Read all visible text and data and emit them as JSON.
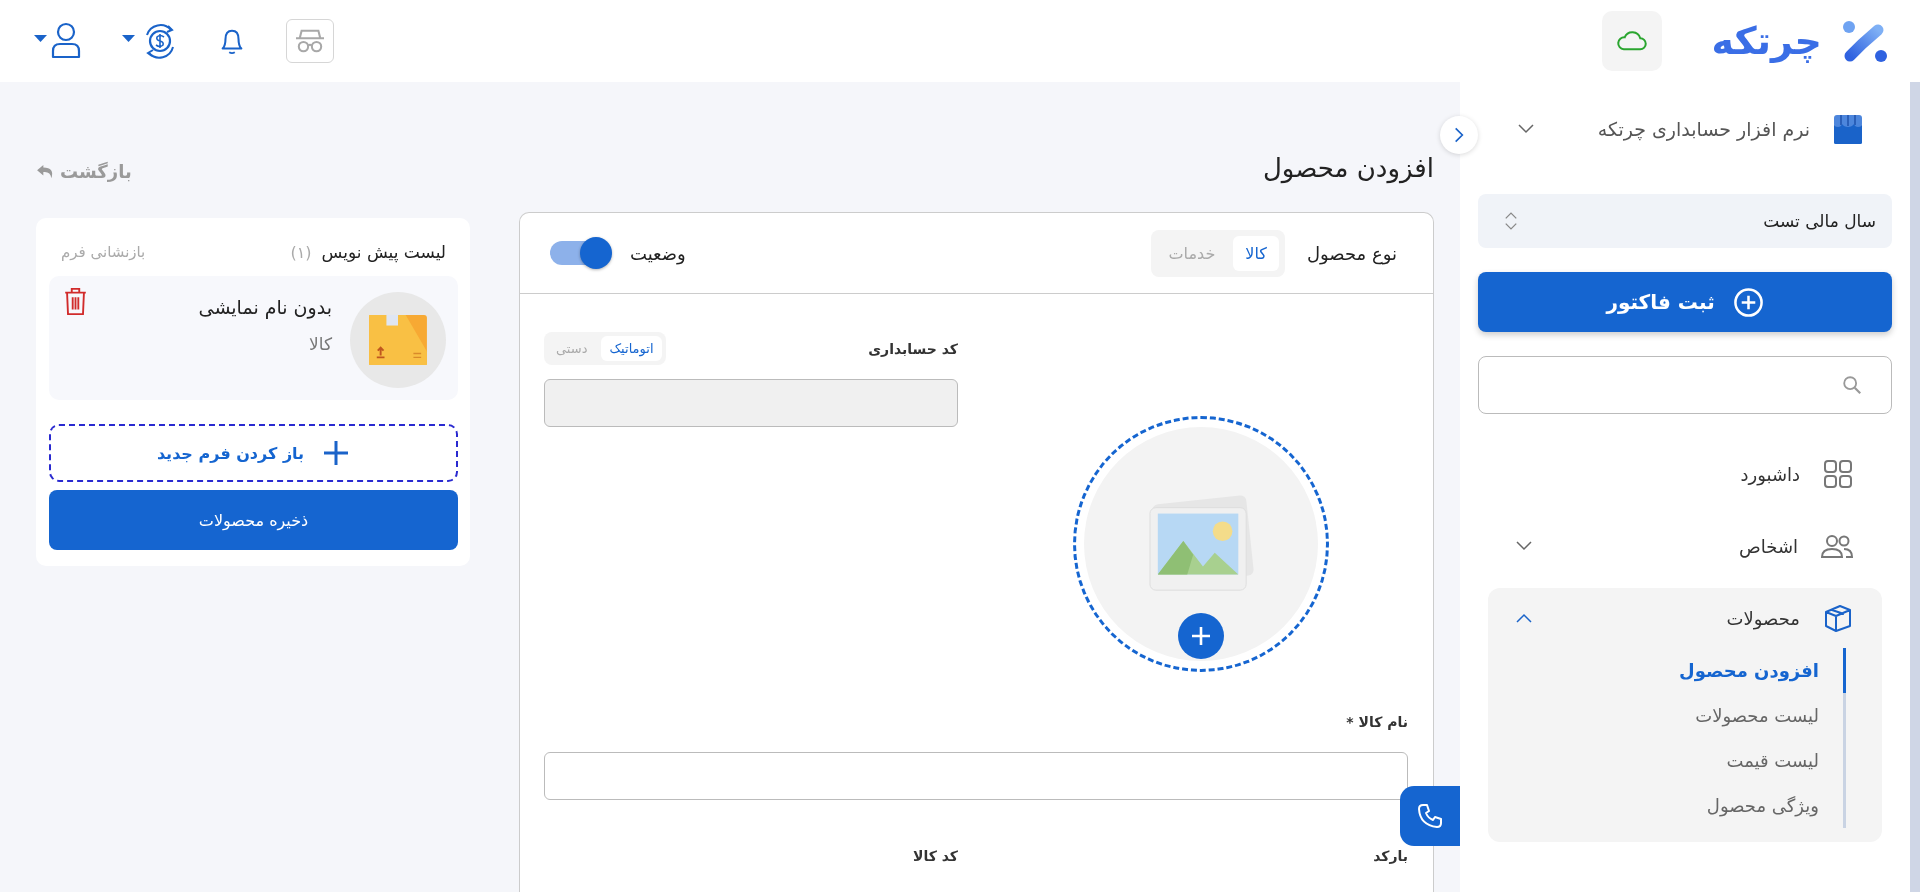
{
  "topbar": {
    "brand": "چرتکه"
  },
  "sidebar": {
    "company": "نرم افزار حسابداری چرتکه",
    "fiscal_year": "سال مالی تست",
    "primary_button": "ثبت فاکتور",
    "menu": [
      {
        "label": "داشبورد"
      },
      {
        "label": "اشخاص",
        "expanded": false
      },
      {
        "label": "محصولات",
        "expanded": true,
        "children": [
          {
            "label": "افزودن محصول",
            "selected": true
          },
          {
            "label": "لیست محصولات",
            "selected": false
          },
          {
            "label": "لیست قیمت",
            "selected": false
          },
          {
            "label": "ویژگی محصول",
            "selected": false
          }
        ]
      }
    ]
  },
  "page": {
    "title": "افزودن محصول",
    "back": "بازگشت"
  },
  "form": {
    "product_type": {
      "label": "نوع محصول",
      "options": [
        {
          "label": "کالا",
          "selected": true
        },
        {
          "label": "خدمات",
          "selected": false
        }
      ]
    },
    "status": {
      "label": "وضعیت",
      "on": true
    },
    "accounting_code": {
      "label": "کد حسابداری",
      "disabled": true,
      "modes": [
        {
          "label": "اتوماتیک",
          "selected": true
        },
        {
          "label": "دستی",
          "selected": false
        }
      ]
    },
    "name": {
      "label": "نام کالا *"
    },
    "barcode": {
      "label": "بارکد"
    },
    "product_code": {
      "label": "کد کالا"
    }
  },
  "drafts": {
    "title": "لیست پیش نویس",
    "count": "(۱)",
    "reset": "بازنشانی فرم",
    "items": [
      {
        "name": "بدون نام نمایشی",
        "type": "کالا"
      }
    ],
    "new_form": "باز کردن فرم جدید",
    "save": "ذخیره محصولات"
  }
}
